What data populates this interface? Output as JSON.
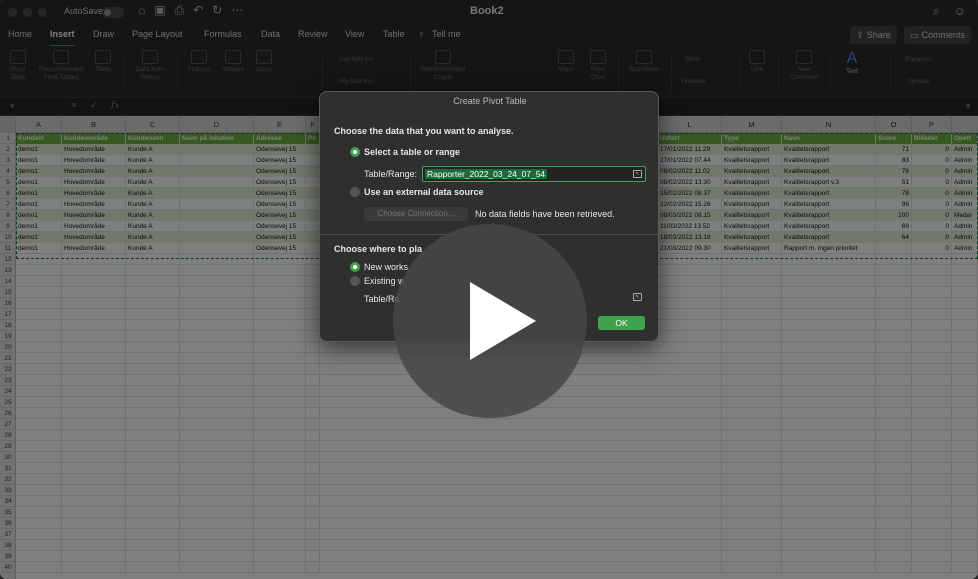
{
  "window": {
    "autosave_label": "AutoSave",
    "title": "Book2"
  },
  "menu": {
    "tabs": [
      "Home",
      "Insert",
      "Draw",
      "Page Layout",
      "Formulas",
      "Data",
      "Review",
      "View",
      "Table"
    ],
    "active": "Insert",
    "tell_me": "Tell me",
    "share": "Share",
    "comments": "Comments"
  },
  "ribbon": {
    "items": [
      "Pivot Table",
      "Recommended Pivot Tables",
      "Table",
      "Data from Picture",
      "Pictures",
      "Shapes",
      "Icons",
      "Get Add-ins",
      "My Add-ins",
      "Recommended Charts",
      "Maps",
      "Pivot Chart",
      "Sparklines",
      "Slicer",
      "Timeline",
      "Link",
      "New Comment",
      "Text",
      "Equation",
      "Symbol"
    ]
  },
  "formula_bar": {
    "fx": "fx"
  },
  "sheet": {
    "columns": [
      "A",
      "B",
      "C",
      "D",
      "E",
      "F",
      "L",
      "M",
      "N",
      "O",
      "P"
    ],
    "row_numbers": [
      "1",
      "2",
      "3",
      "4",
      "5",
      "6",
      "7",
      "8",
      "9",
      "10",
      "11",
      "12",
      "13",
      "14",
      "15",
      "16",
      "17",
      "18",
      "19",
      "20",
      "21",
      "22",
      "23",
      "24",
      "25",
      "26",
      "27",
      "28",
      "29",
      "30",
      "31",
      "32",
      "33",
      "34",
      "35",
      "36",
      "37",
      "38",
      "39",
      "40"
    ],
    "header_left": [
      "Kundeni",
      "Kundeområde",
      "Kundenavn",
      "Navn på lokation",
      "Adresse",
      "Po"
    ],
    "header_right": [
      "Udført",
      "Type",
      "Navn",
      "Score",
      "Billeder",
      "Opett"
    ],
    "rows_left": [
      [
        "demo1",
        "Hovedområde",
        "Kunde A",
        "",
        "Odensevej 15"
      ],
      [
        "demo1",
        "Hovedområde",
        "Kunde A",
        "",
        "Odensevej 15"
      ],
      [
        "demo1",
        "Hovedområde",
        "Kunde A",
        "",
        "Odensevej 15"
      ],
      [
        "demo1",
        "Hovedområde",
        "Kunde A",
        "",
        "Odensevej 15"
      ],
      [
        "demo1",
        "Hovedområde",
        "Kunde A",
        "",
        "Odensevej 15"
      ],
      [
        "demo1",
        "Hovedområde",
        "Kunde A",
        "",
        "Odensevej 15"
      ],
      [
        "demo1",
        "Hovedområde",
        "Kunde A",
        "",
        "Odensevej 15"
      ],
      [
        "demo1",
        "Hovedområde",
        "Kunde A",
        "",
        "Odensevej 15"
      ],
      [
        "demo1",
        "Hovedområde",
        "Kunde A",
        "",
        "Odensevej 15"
      ],
      [
        "demo1",
        "Hovedområde",
        "Kunde A",
        "",
        "Odensevej 15"
      ]
    ],
    "rows_right": [
      [
        "17/01/2022 11.29",
        "Kvalitetsrapport",
        "Kvalitetsrapport",
        "71",
        "0",
        "Admin"
      ],
      [
        "27/01/2022 07.44",
        "Kvalitetsrapport",
        "Kvalitetsrapport",
        "83",
        "0",
        "Admin"
      ],
      [
        "08/02/2022 11.02",
        "Kvalitetsrapport",
        "Kvalitetsrapport",
        "76",
        "0",
        "Admin"
      ],
      [
        "08/02/2022 13.30",
        "Kvalitetsrapport",
        "Kvalitetsrapport v.3",
        "51",
        "0",
        "Admin"
      ],
      [
        "15/02/2022 08.37",
        "Kvalitetsrapport",
        "Kvalitetsrapport",
        "78",
        "0",
        "Admin"
      ],
      [
        "22/02/2022 15.26",
        "Kvalitetsrapport",
        "Kvalitetsrapport",
        "96",
        "0",
        "Admin"
      ],
      [
        "08/03/2022 08.15",
        "Kvalitetsrapport",
        "Kvalitetsrapport",
        "100",
        "0",
        "Medar"
      ],
      [
        "11/03/2022 13.52",
        "Kvalitetsrapport",
        "Kvalitetsrapport",
        "69",
        "0",
        "Admin"
      ],
      [
        "18/03/2022 13.18",
        "Kvalitetsrapport",
        "Kvalitetsrapport",
        "64",
        "0",
        "Admin"
      ],
      [
        "21/03/2022 09.30",
        "Kvalitetsrapport",
        "Rapport m. ingen prioritet",
        "",
        "0",
        "Admin"
      ]
    ]
  },
  "dialog": {
    "title": "Create Pivot Table",
    "choose_data": "Choose the data that you want to analyse.",
    "select_table": "Select a table or range",
    "table_range_label": "Table/Range:",
    "table_range_value": "Rapporter_2022_03_24_07_54",
    "external_source": "Use an external data source",
    "choose_connection": "Choose Connection...",
    "no_fields": "No data fields have been retrieved.",
    "choose_where": "Choose where to pla",
    "new_worksheet": "New works",
    "existing": "Existing w",
    "table_range_label2": "Table/Ra",
    "ok": "OK"
  }
}
